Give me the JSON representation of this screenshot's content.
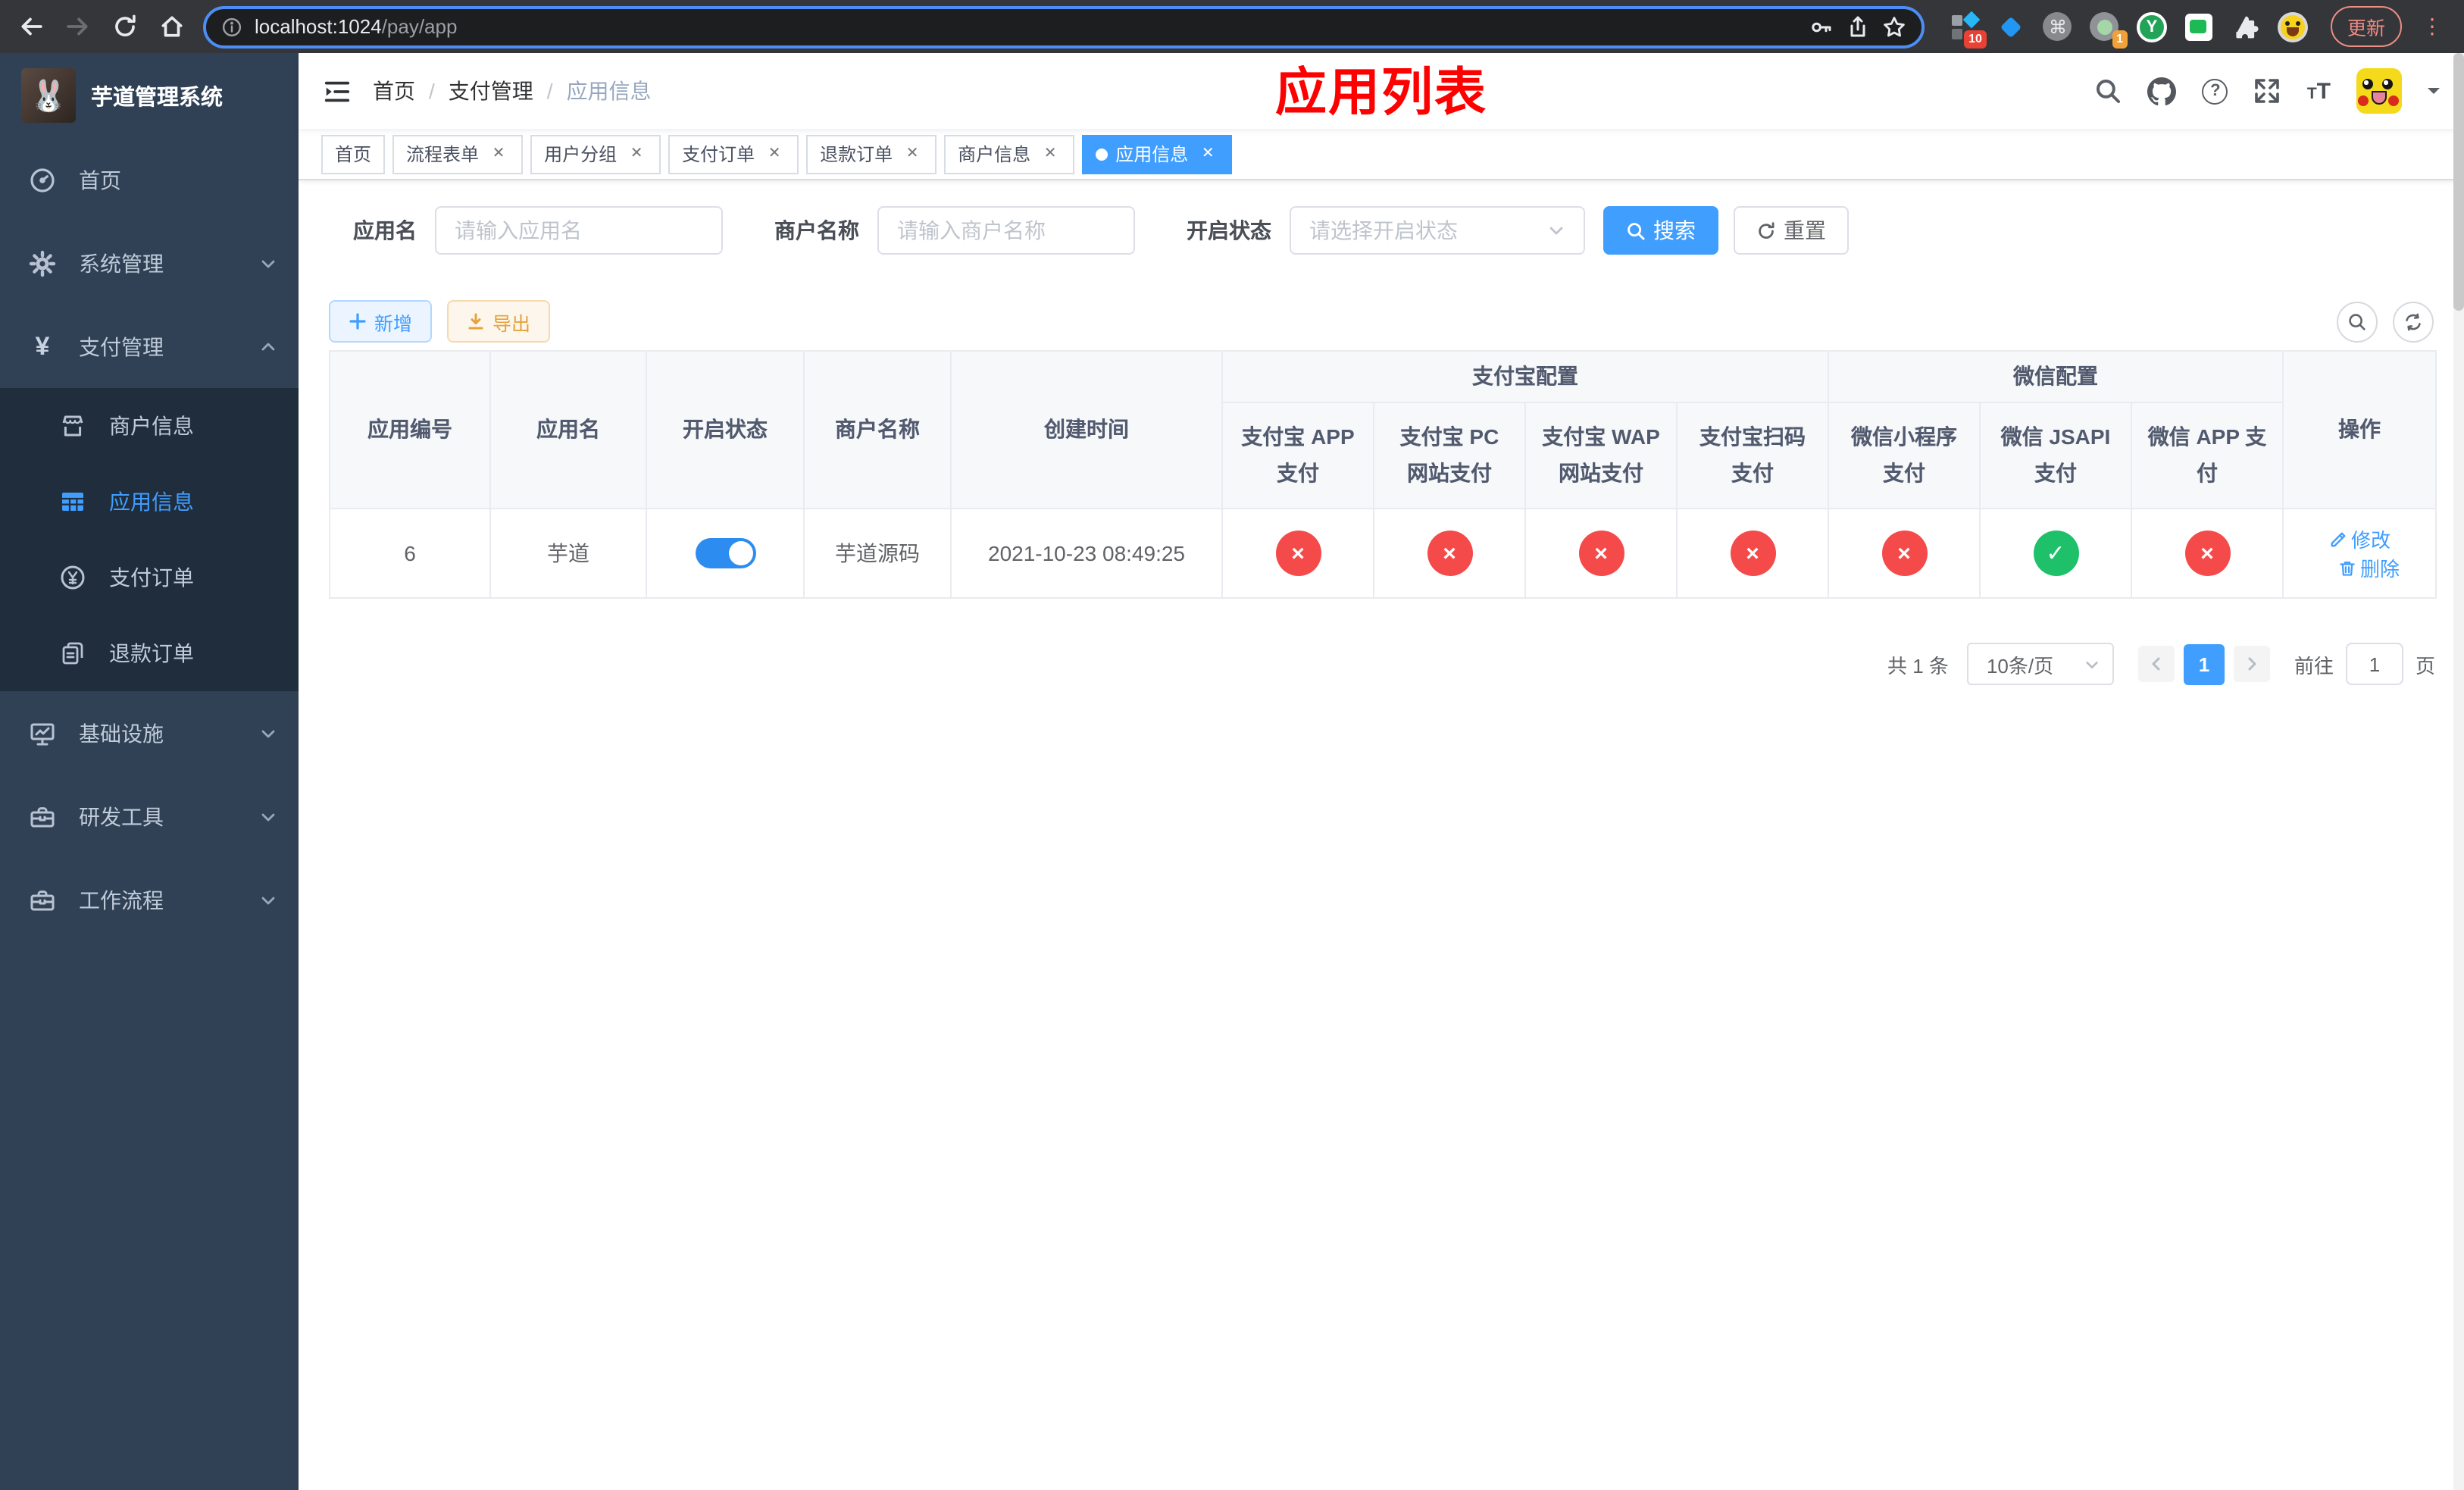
{
  "colors": {
    "accent": "#409eff",
    "success": "#1ec06a",
    "danger": "#f54a4a",
    "warning": "#e6a23c",
    "sidebar_bg": "#304156",
    "submenu_bg": "#1f2d3d",
    "annotation_red": "#fe0000"
  },
  "browser": {
    "url_host": "localhost:1024",
    "url_path": "/pay/app",
    "ext_badge_1": "10",
    "ext_badge_2": "1",
    "ext_y_label": "Y",
    "cmd_glyph": "⌘",
    "update_label": "更新",
    "kebab_glyph": "⋮"
  },
  "annotation": "应用列表",
  "sidebar": {
    "title": "芋道管理系统",
    "logo_emoji": "🐰",
    "items": [
      {
        "label": "首页"
      },
      {
        "label": "系统管理"
      },
      {
        "label": "支付管理"
      },
      {
        "label": "商户信息"
      },
      {
        "label": "应用信息",
        "active": true
      },
      {
        "label": "支付订单"
      },
      {
        "label": "退款订单"
      },
      {
        "label": "基础设施"
      },
      {
        "label": "研发工具"
      },
      {
        "label": "工作流程"
      }
    ],
    "yen_glyph": "¥"
  },
  "breadcrumb": {
    "items": [
      "首页",
      "支付管理",
      "应用信息"
    ],
    "separator": "/"
  },
  "tabs": [
    {
      "label": "首页",
      "active": false
    },
    {
      "label": "流程表单",
      "active": false
    },
    {
      "label": "用户分组",
      "active": false
    },
    {
      "label": "支付订单",
      "active": false
    },
    {
      "label": "退款订单",
      "active": false
    },
    {
      "label": "商户信息",
      "active": false
    },
    {
      "label": "应用信息",
      "active": true
    }
  ],
  "filters": {
    "app_name_label": "应用名",
    "app_name_placeholder": "请输入应用名",
    "app_name_value": "",
    "merchant_label": "商户名称",
    "merchant_placeholder": "请输入商户名称",
    "merchant_value": "",
    "status_label": "开启状态",
    "status_placeholder": "请选择开启状态",
    "search_label": "搜索",
    "reset_label": "重置"
  },
  "toolbar": {
    "add_label": "新增",
    "export_label": "导出"
  },
  "table": {
    "group_headers": [
      {
        "label": "支付宝配置",
        "span": 4
      },
      {
        "label": "微信配置",
        "span": 3
      }
    ],
    "columns": [
      "应用编号",
      "应用名",
      "开启状态",
      "商户名称",
      "创建时间",
      "支付宝 APP 支付",
      "支付宝 PC 网站支付",
      "支付宝 WAP 网站支付",
      "支付宝扫码支付",
      "微信小程序支付",
      "微信 JSAPI 支付",
      "微信 APP 支付",
      "操作"
    ],
    "rows": [
      {
        "id": "6",
        "name": "芋道",
        "enabled": true,
        "merchant": "芋道源码",
        "created": "2021-10-23 08:49:25",
        "statuses": [
          "no",
          "no",
          "no",
          "no",
          "no",
          "yes",
          "no"
        ],
        "edit_label": "修改",
        "delete_label": "删除"
      }
    ]
  },
  "pagination": {
    "total_text": "共 1 条",
    "page_size_text": "10条/页",
    "current_page": "1",
    "goto_label": "前往",
    "goto_value": "1",
    "page_suffix": "页"
  }
}
